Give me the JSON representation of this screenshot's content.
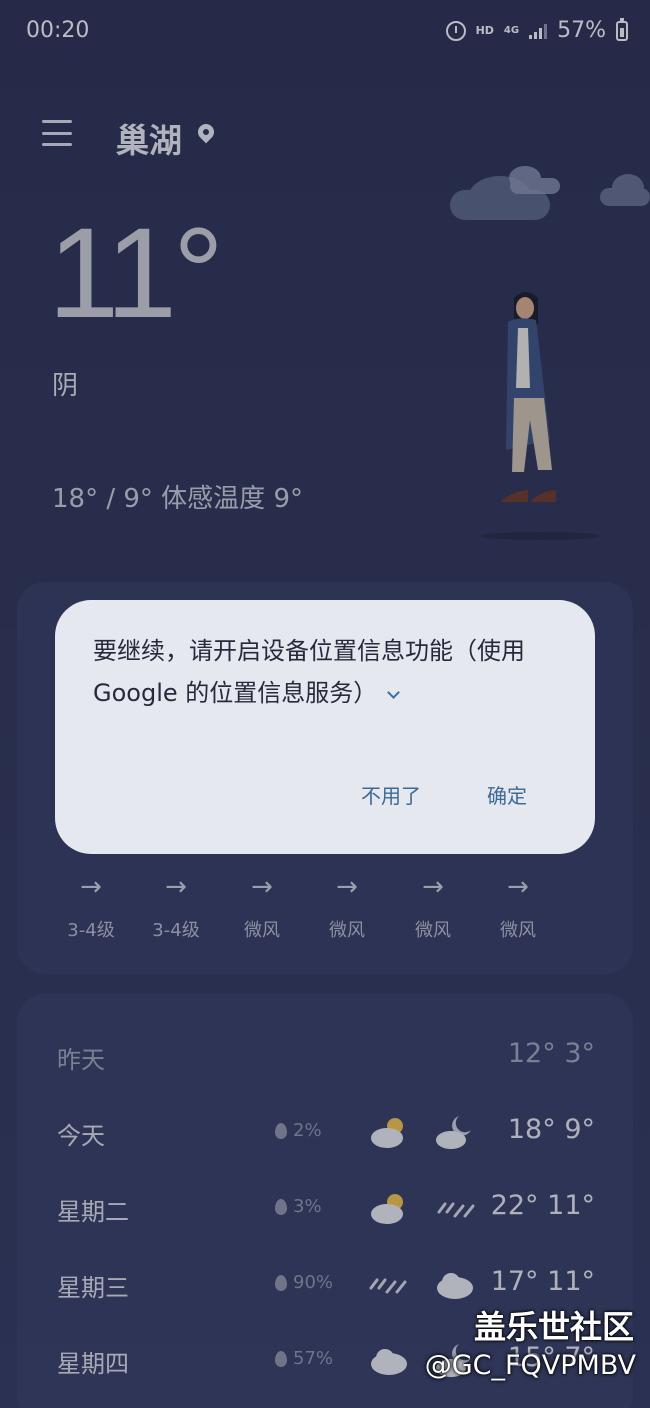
{
  "status_bar": {
    "time": "00:20",
    "hd": "HD",
    "network": "4G",
    "battery": "57%"
  },
  "header": {
    "city": "巢湖"
  },
  "current": {
    "temperature": "11°",
    "condition": "阴",
    "range_feels": "18° / 9° 体感温度 9°"
  },
  "hourly": {
    "wind": [
      {
        "arrow": "→",
        "label": "3-4级"
      },
      {
        "arrow": "→",
        "label": "3-4级"
      },
      {
        "arrow": "→",
        "label": "微风"
      },
      {
        "arrow": "→",
        "label": "微风"
      },
      {
        "arrow": "→",
        "label": "微风"
      },
      {
        "arrow": "→",
        "label": "微风"
      }
    ]
  },
  "daily": [
    {
      "day": "昨天",
      "pop": "",
      "icon_day": "",
      "icon_night": "",
      "temps": "12°  3°"
    },
    {
      "day": "今天",
      "pop": "2%",
      "icon_day": "partly-cloudy-icon",
      "icon_night": "cloudy-night-icon",
      "temps": "18°  9°"
    },
    {
      "day": "星期二",
      "pop": "3%",
      "icon_day": "partly-cloudy-icon",
      "icon_night": "rain-icon",
      "temps": "22° 11°"
    },
    {
      "day": "星期三",
      "pop": "90%",
      "icon_day": "rain-icon",
      "icon_night": "cloud-icon",
      "temps": "17° 11°"
    },
    {
      "day": "星期四",
      "pop": "57%",
      "icon_day": "cloud-icon",
      "icon_night": "cloudy-night-icon",
      "temps": "15°  7°"
    }
  ],
  "dialog": {
    "message": "要继续，请开启设备位置信息功能（使用 Google 的位置信息服务）",
    "cancel": "不用了",
    "confirm": "确定"
  },
  "watermark": {
    "line1": "盖乐世社区",
    "line2": "@GC_FQVPMBV"
  },
  "colors": {
    "background": "#2f3558",
    "dialog": "#e6e8f0",
    "accent": "#3d6a93"
  }
}
